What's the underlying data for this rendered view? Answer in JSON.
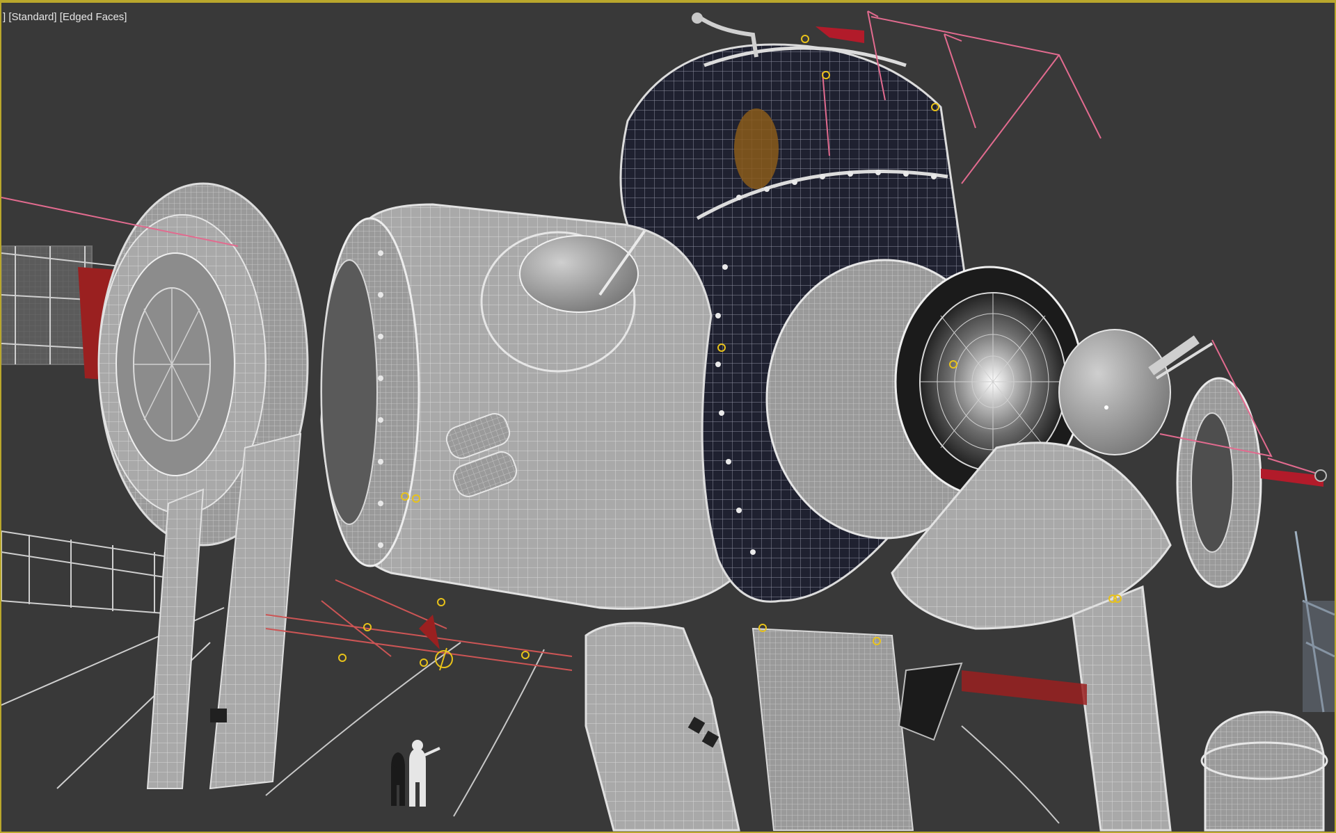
{
  "viewport": {
    "label_bracket": "]",
    "shading_mode": "[Standard]",
    "display_mode": "[Edged Faces]",
    "frame_color": "#b9a72c",
    "background_color": "#393939"
  },
  "scene": {
    "wire_color": "#bdbdbd",
    "dark_hull_color": "#1c1e2c",
    "truss_red_color": "#9a2020",
    "helper_pink_color": "#e26b8f",
    "helper_yellow_color": "#e8c21a",
    "icons": [
      "gizmo-circle-icon",
      "camera-target-icon",
      "human-figure-icon"
    ]
  }
}
